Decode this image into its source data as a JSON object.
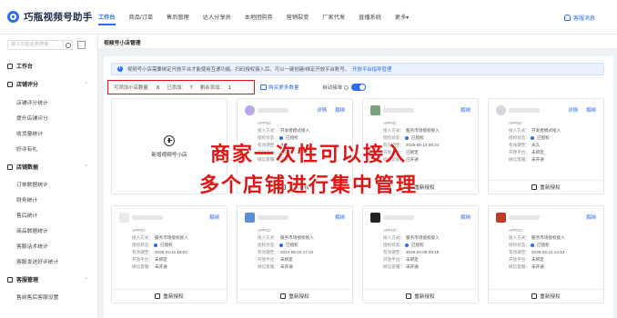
{
  "app": {
    "title": "巧瓶视频号助手"
  },
  "nav": [
    "工作台",
    "商品/订单",
    "售后管理",
    "达人分享员",
    "本地团购券",
    "营销裂变",
    "厂家代发",
    "直播系统",
    "更多▾"
  ],
  "header_right": {
    "link": "客服消息"
  },
  "sidebar": {
    "search_placeholder": "输入功能名称搜索",
    "groups": [
      {
        "label": "工作台",
        "items": []
      },
      {
        "label": "店铺评分",
        "items": [
          "店铺评分统计",
          "提升店铺评分",
          "收货量统计",
          "好评有礼"
        ]
      },
      {
        "label": "店铺数据",
        "items": [
          "订单数据统计",
          "财务统计",
          "售后统计",
          "商品数据统计",
          "客服话术统计",
          "客服发送好评统计"
        ]
      },
      {
        "label": "客服管理",
        "items": [
          "售前售后客服设置"
        ]
      }
    ]
  },
  "page": {
    "title": "视频号小店管理"
  },
  "notice": {
    "text": "视频号小店需要绑定开放平台才能使用互通功能。扫码授权接入后，可以一键创建/绑定开放平台账号。",
    "link": "开放平台指导管理"
  },
  "stats": {
    "limit_label": "可添加小店数量：",
    "limit": "8",
    "added_label": "已添加：",
    "added": "7",
    "remain_label": "剩余添加：",
    "remain": "1"
  },
  "buy_label": "购买更多数量",
  "auto_label": "自动接单",
  "add_card": {
    "label": "新增视频号小店"
  },
  "card_labels": {
    "appid": "APPID：",
    "access": "接入方式：",
    "status": "授权状态：",
    "expire": "有效期至：",
    "open": "开放平台：",
    "wx": "微信客服：",
    "reauth": "重新授权",
    "detail": "详情",
    "unbind": "解绑"
  },
  "cards": [
    {
      "access": "开发者模式接入",
      "status": "已授权",
      "expire": "永久",
      "open": "已绑定",
      "wx": "已开通"
    },
    {
      "access": "服务市场授权接入",
      "status": "已授权",
      "expire": "2025-06-14 06:24",
      "open": "已绑定",
      "wx": "已开通"
    },
    {
      "access": "开发者模式接入",
      "status": "已授权",
      "expire": "永久",
      "open": "未绑定",
      "wx": "未开通"
    },
    {
      "access": "服务市场授权接入",
      "status": "已授权",
      "expire": "2025-04-11 18:02",
      "open": "未绑定",
      "wx": "未开通"
    },
    {
      "access": "服务市场授权接入",
      "status": "已授权",
      "expire": "2024-08-22 17:22",
      "open": "未绑定",
      "wx": "未开通"
    },
    {
      "access": "服务市场授权接入",
      "status": "已授权",
      "expire": "2025-04-09 08:18",
      "open": "未绑定",
      "wx": "未开通"
    },
    {
      "access": "服务市场授权接入",
      "status": "已授权",
      "expire": "2025-03-21 14:13",
      "open": "未绑定",
      "wx": "未开通"
    }
  ],
  "overlay": {
    "line1": "商家一次性可以接入",
    "line2": "多个店铺进行集中管理"
  },
  "colors": {
    "accent": "#2a6cf6",
    "highlight": "#e01515",
    "warning": "#e6392b"
  }
}
